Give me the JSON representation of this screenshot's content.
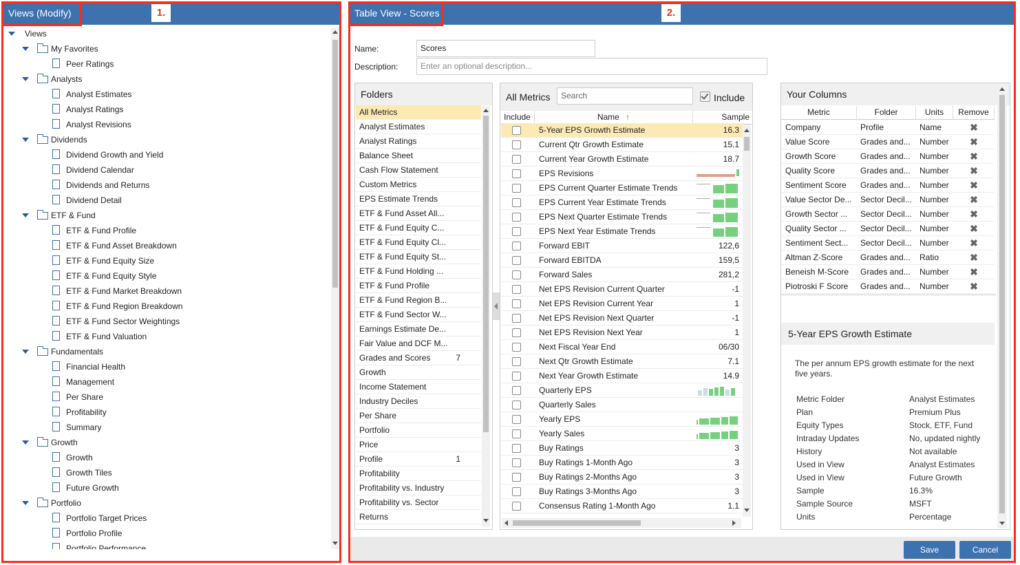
{
  "left_panel": {
    "title": "Views (Modify)",
    "badge": "1.",
    "tree": [
      {
        "label": "Views",
        "level": 0,
        "type": "root"
      },
      {
        "label": "My Favorites",
        "level": 1,
        "type": "folder"
      },
      {
        "label": "Peer Ratings",
        "level": 2,
        "type": "doc"
      },
      {
        "label": "Analysts",
        "level": 1,
        "type": "folder"
      },
      {
        "label": "Analyst Estimates",
        "level": 2,
        "type": "doc"
      },
      {
        "label": "Analyst Ratings",
        "level": 2,
        "type": "doc"
      },
      {
        "label": "Analyst Revisions",
        "level": 2,
        "type": "doc"
      },
      {
        "label": "Dividends",
        "level": 1,
        "type": "folder"
      },
      {
        "label": "Dividend Growth and Yield",
        "level": 2,
        "type": "doc"
      },
      {
        "label": "Dividend Calendar",
        "level": 2,
        "type": "doc"
      },
      {
        "label": "Dividends and Returns",
        "level": 2,
        "type": "doc"
      },
      {
        "label": "Dividend Detail",
        "level": 2,
        "type": "doc"
      },
      {
        "label": "ETF & Fund",
        "level": 1,
        "type": "folder"
      },
      {
        "label": "ETF & Fund Profile",
        "level": 2,
        "type": "doc"
      },
      {
        "label": "ETF & Fund Asset Breakdown",
        "level": 2,
        "type": "doc"
      },
      {
        "label": "ETF & Fund Equity Size",
        "level": 2,
        "type": "doc"
      },
      {
        "label": "ETF & Fund Equity Style",
        "level": 2,
        "type": "doc"
      },
      {
        "label": "ETF & Fund Market Breakdown",
        "level": 2,
        "type": "doc"
      },
      {
        "label": "ETF & Fund Region Breakdown",
        "level": 2,
        "type": "doc"
      },
      {
        "label": "ETF & Fund Sector Weightings",
        "level": 2,
        "type": "doc"
      },
      {
        "label": "ETF & Fund Valuation",
        "level": 2,
        "type": "doc"
      },
      {
        "label": "Fundamentals",
        "level": 1,
        "type": "folder"
      },
      {
        "label": "Financial Health",
        "level": 2,
        "type": "doc"
      },
      {
        "label": "Management",
        "level": 2,
        "type": "doc"
      },
      {
        "label": "Per Share",
        "level": 2,
        "type": "doc"
      },
      {
        "label": "Profitability",
        "level": 2,
        "type": "doc"
      },
      {
        "label": "Summary",
        "level": 2,
        "type": "doc"
      },
      {
        "label": "Growth",
        "level": 1,
        "type": "folder"
      },
      {
        "label": "Growth",
        "level": 2,
        "type": "doc"
      },
      {
        "label": "Growth Tiles",
        "level": 2,
        "type": "doc"
      },
      {
        "label": "Future Growth",
        "level": 2,
        "type": "doc"
      },
      {
        "label": "Portfolio",
        "level": 1,
        "type": "folder"
      },
      {
        "label": "Portfolio Target Prices",
        "level": 2,
        "type": "doc"
      },
      {
        "label": "Portfolio Profile",
        "level": 2,
        "type": "doc"
      },
      {
        "label": "Portfolio Performance",
        "level": 2,
        "type": "doc"
      }
    ]
  },
  "right_panel": {
    "title": "Table View - Scores",
    "badge": "2.",
    "name_label": "Name:",
    "name_value": "Scores",
    "description_label": "Description:",
    "description_placeholder": "Enter an optional description..."
  },
  "folders": {
    "title": "Folders",
    "items": [
      {
        "label": "All Metrics",
        "count": "",
        "selected": true
      },
      {
        "label": "Analyst Estimates",
        "count": ""
      },
      {
        "label": "Analyst Ratings",
        "count": ""
      },
      {
        "label": "Balance Sheet",
        "count": ""
      },
      {
        "label": "Cash Flow Statement",
        "count": ""
      },
      {
        "label": "Custom Metrics",
        "count": ""
      },
      {
        "label": "EPS Estimate Trends",
        "count": ""
      },
      {
        "label": "ETF & Fund Asset All...",
        "count": ""
      },
      {
        "label": "ETF & Fund Equity C...",
        "count": ""
      },
      {
        "label": "ETF & Fund Equity Cl...",
        "count": ""
      },
      {
        "label": "ETF & Fund Equity St...",
        "count": ""
      },
      {
        "label": "ETF & Fund Holding ...",
        "count": ""
      },
      {
        "label": "ETF & Fund Profile",
        "count": ""
      },
      {
        "label": "ETF & Fund Region B...",
        "count": ""
      },
      {
        "label": "ETF & Fund Sector W...",
        "count": ""
      },
      {
        "label": "Earnings Estimate De...",
        "count": ""
      },
      {
        "label": "Fair Value and DCF M...",
        "count": ""
      },
      {
        "label": "Grades and Scores",
        "count": "7"
      },
      {
        "label": "Growth",
        "count": ""
      },
      {
        "label": "Income Statement",
        "count": ""
      },
      {
        "label": "Industry Deciles",
        "count": ""
      },
      {
        "label": "Per Share",
        "count": ""
      },
      {
        "label": "Portfolio",
        "count": ""
      },
      {
        "label": "Price",
        "count": ""
      },
      {
        "label": "Profile",
        "count": "1"
      },
      {
        "label": "Profitability",
        "count": ""
      },
      {
        "label": "Profitability vs. Industry",
        "count": ""
      },
      {
        "label": "Profitability vs. Sector",
        "count": ""
      },
      {
        "label": "Returns",
        "count": ""
      }
    ]
  },
  "metrics": {
    "title": "All Metrics",
    "search_placeholder": "Search",
    "include_label": "Include",
    "col_include": "Include",
    "col_name": "Name",
    "col_sample": "Sample",
    "rows": [
      {
        "name": "5-Year EPS Growth Estimate",
        "sample": "16.3",
        "spark": "",
        "selected": true
      },
      {
        "name": "Current Qtr Growth Estimate",
        "sample": "15.1",
        "spark": ""
      },
      {
        "name": "Current Year Growth Estimate",
        "sample": "18.7",
        "spark": ""
      },
      {
        "name": "EPS Revisions",
        "sample": "",
        "spark": "revisions"
      },
      {
        "name": "EPS Current Quarter Estimate Trends",
        "sample": "",
        "spark": "trend"
      },
      {
        "name": "EPS Current Year Estimate Trends",
        "sample": "",
        "spark": "trend"
      },
      {
        "name": "EPS Next Quarter Estimate Trends",
        "sample": "",
        "spark": "trend"
      },
      {
        "name": "EPS Next Year Estimate Trends",
        "sample": "",
        "spark": "trend"
      },
      {
        "name": "Forward EBIT",
        "sample": "122,6",
        "spark": ""
      },
      {
        "name": "Forward EBITDA",
        "sample": "159,5",
        "spark": ""
      },
      {
        "name": "Forward Sales",
        "sample": "281,2",
        "spark": ""
      },
      {
        "name": "Net EPS Revision Current Quarter",
        "sample": "-1",
        "spark": ""
      },
      {
        "name": "Net EPS Revision Current Year",
        "sample": "1",
        "spark": ""
      },
      {
        "name": "Net EPS Revision Next Quarter",
        "sample": "-1",
        "spark": ""
      },
      {
        "name": "Net EPS Revision Next Year",
        "sample": "1",
        "spark": ""
      },
      {
        "name": "Next Fiscal Year End",
        "sample": "06/30",
        "spark": ""
      },
      {
        "name": "Next Qtr Growth Estimate",
        "sample": "7.1",
        "spark": ""
      },
      {
        "name": "Next Year Growth Estimate",
        "sample": "14.9",
        "spark": ""
      },
      {
        "name": "Quarterly EPS",
        "sample": "",
        "spark": "quarterly"
      },
      {
        "name": "Quarterly Sales",
        "sample": "",
        "spark": ""
      },
      {
        "name": "Yearly EPS",
        "sample": "",
        "spark": "yearly"
      },
      {
        "name": "Yearly Sales",
        "sample": "",
        "spark": "yearly"
      },
      {
        "name": "Buy Ratings",
        "sample": "3",
        "spark": ""
      },
      {
        "name": "Buy Ratings 1-Month Ago",
        "sample": "3",
        "spark": ""
      },
      {
        "name": "Buy Ratings 2-Months Ago",
        "sample": "3",
        "spark": ""
      },
      {
        "name": "Buy Ratings 3-Months Ago",
        "sample": "3",
        "spark": ""
      },
      {
        "name": "Consensus Rating 1-Month Ago",
        "sample": "1.1",
        "spark": ""
      }
    ]
  },
  "your_columns": {
    "title": "Your Columns",
    "col_metric": "Metric",
    "col_folder": "Folder",
    "col_units": "Units",
    "col_remove": "Remove",
    "rows": [
      {
        "metric": "Company",
        "folder": "Profile",
        "units": "Name"
      },
      {
        "metric": "Value Score",
        "folder": "Grades and...",
        "units": "Number"
      },
      {
        "metric": "Growth Score",
        "folder": "Grades and...",
        "units": "Number"
      },
      {
        "metric": "Quality Score",
        "folder": "Grades and...",
        "units": "Number"
      },
      {
        "metric": "Sentiment Score",
        "folder": "Grades and...",
        "units": "Number"
      },
      {
        "metric": "Value Sector De...",
        "folder": "Sector Decil...",
        "units": "Number"
      },
      {
        "metric": "Growth Sector ...",
        "folder": "Sector Decil...",
        "units": "Number"
      },
      {
        "metric": "Quality Sector ...",
        "folder": "Sector Decil...",
        "units": "Number"
      },
      {
        "metric": "Sentiment Sect...",
        "folder": "Sector Decil...",
        "units": "Number"
      },
      {
        "metric": "Altman Z-Score",
        "folder": "Grades and...",
        "units": "Ratio"
      },
      {
        "metric": "Beneish M-Score",
        "folder": "Grades and...",
        "units": "Number"
      },
      {
        "metric": "Piotroski F Score",
        "folder": "Grades and...",
        "units": "Number"
      }
    ]
  },
  "detail": {
    "title": "5-Year EPS Growth Estimate",
    "description": "The per annum EPS growth estimate for the next five years.",
    "fields": [
      {
        "k": "Metric Folder",
        "v": "Analyst Estimates"
      },
      {
        "k": "Plan",
        "v": "Premium Plus"
      },
      {
        "k": "Equity Types",
        "v": "Stock, ETF, Fund"
      },
      {
        "k": "Intraday Updates",
        "v": "No, updated nightly"
      },
      {
        "k": "History",
        "v": "Not available"
      },
      {
        "k": "Used in View",
        "v": "Analyst Estimates"
      },
      {
        "k": "Used in View",
        "v": "Future Growth"
      },
      {
        "k": "Sample",
        "v": "16.3%"
      },
      {
        "k": "Sample Source",
        "v": "MSFT"
      },
      {
        "k": "Units",
        "v": "Percentage"
      }
    ]
  },
  "buttons": {
    "save": "Save",
    "cancel": "Cancel"
  },
  "colors": {
    "header": "#3d72ae",
    "highlight": "#e8341c",
    "selected_row": "#fde9b4",
    "spark_green": "#76d17f",
    "spark_red": "#e09c8c"
  }
}
